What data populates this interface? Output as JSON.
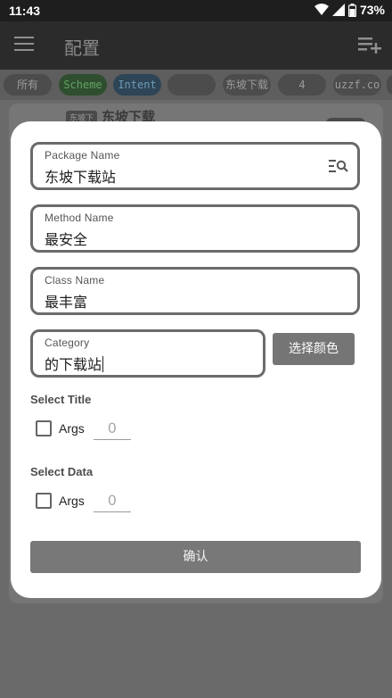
{
  "status": {
    "time": "11:43",
    "battery": "73%"
  },
  "appbar": {
    "title": "配置"
  },
  "chips": [
    "所有",
    "Scheme",
    "Intent",
    "",
    "东坡下载",
    "4",
    "uzzf.co"
  ],
  "background_card": {
    "tag": "东坡下",
    "title": "东坡下载"
  },
  "dialog": {
    "package": {
      "label": "Package Name",
      "value": "东坡下载站"
    },
    "method": {
      "label": "Method Name",
      "value": "最安全"
    },
    "class": {
      "label": "Class Name",
      "value": "最丰富"
    },
    "category": {
      "label": "Category",
      "value": "的下载站"
    },
    "color_button": "选择颜色",
    "select_title": {
      "heading": "Select Title",
      "checkbox_label": "Args",
      "value": "0"
    },
    "select_data": {
      "heading": "Select Data",
      "checkbox_label": "Args",
      "value": "0"
    },
    "confirm": "确认"
  },
  "colors": {
    "dialog_bg": "#ffffff",
    "field_border": "#6b6b6b",
    "button_bg": "#787878",
    "scrim": "#6a6a6a"
  },
  "icons": [
    "wifi-icon",
    "signal-icon",
    "battery-icon",
    "menu-icon",
    "playlist-add-icon",
    "search-list-icon"
  ]
}
